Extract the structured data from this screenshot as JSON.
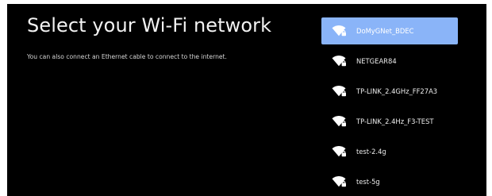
{
  "page": {
    "title": "Select your Wi-Fi network",
    "subtitle": "You can also connect an Ethernet cable to connect to the internet."
  },
  "networks": [
    {
      "ssid": "DoMyGNet_BDEC",
      "selected": true,
      "icon": "wifi-locked-icon"
    },
    {
      "ssid": "NETGEAR84",
      "selected": false,
      "icon": "wifi-locked-icon"
    },
    {
      "ssid": "TP-LINK_2.4GHz_FF27A3",
      "selected": false,
      "icon": "wifi-locked-icon"
    },
    {
      "ssid": "TP-LINK_2.4Hz_F3-TEST",
      "selected": false,
      "icon": "wifi-locked-icon"
    },
    {
      "ssid": "test-2.4g",
      "selected": false,
      "icon": "wifi-locked-icon"
    },
    {
      "ssid": "test-5g",
      "selected": false,
      "icon": "wifi-locked-icon"
    }
  ],
  "colors": {
    "background": "#000000",
    "selected_highlight": "#8ab4f8",
    "text": "#ffffff"
  }
}
